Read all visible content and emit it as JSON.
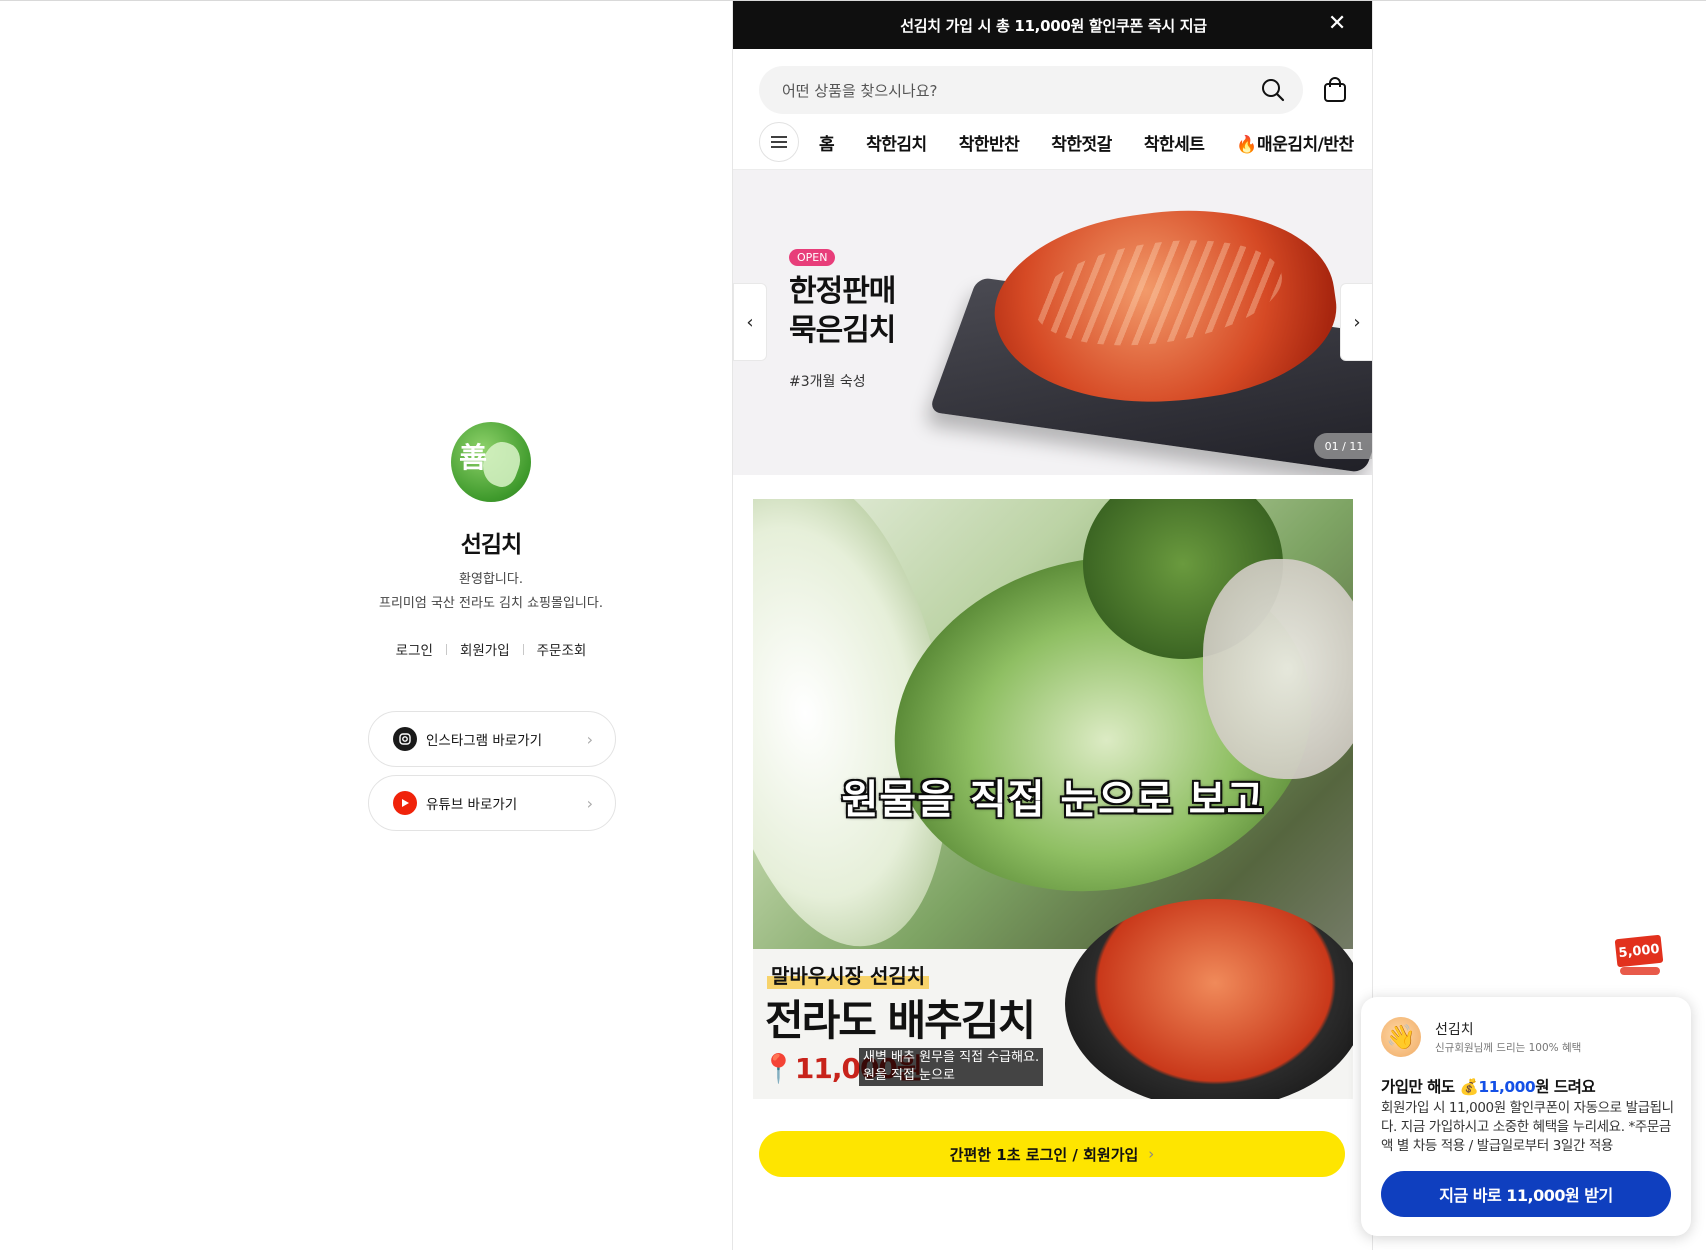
{
  "brand": {
    "name": "선김치",
    "logo_char": "善",
    "welcome_line1": "환영합니다.",
    "welcome_line2": "프리미엄 국산 전라도 김치 쇼핑몰입니다."
  },
  "auth_links": [
    "로그인",
    "회원가입",
    "주문조회"
  ],
  "social": {
    "instagram": "인스타그램 바로가기",
    "youtube": "유튜브 바로가기"
  },
  "promo_bar": {
    "text": "선김치 가입 시 총 11,000원 할인쿠폰 즉시 지급"
  },
  "search": {
    "placeholder": "어떤 상품을 찾으시나요?"
  },
  "nav": {
    "items": [
      "홈",
      "착한김치",
      "착한반찬",
      "착한젓갈",
      "착한세트",
      "🔥매운김치/반찬"
    ]
  },
  "banner": {
    "badge": "OPEN",
    "title_line1": "한정판매",
    "title_line2": "묵은김치",
    "tag": "#3개월 숙성",
    "counter": "01 / 11"
  },
  "video": {
    "caption": "원물을 직접 눈으로 보고",
    "market_label": "말바우시장 선김치",
    "title": "전라도 배추김치",
    "price_text": "📍11,000원",
    "subtitle_line1": "새벽 배추 원무을 직접 수급해요.",
    "subtitle_line2": "원을 직접 눈으로"
  },
  "login_button": {
    "label": "간편한 1초 로그인 / 회원가입",
    "chevron": "›"
  },
  "mini_coupon": {
    "amount": "5,000"
  },
  "popup": {
    "brand": "선김치",
    "sub": "신규회원님께 드리는 100% 혜택",
    "head_prefix": "가입만 해도 💰",
    "head_amount": "11,000",
    "head_suffix": "원 드려요",
    "body": "회원가입 시 11,000원 할인쿠폰이 자동으로 발급됩니다. 지금 가입하시고 소중한 혜택을 누리세요. *주문금액 별 차등 적용 / 발급일로부터 3일간 적용",
    "button": "지금 바로 11,000원 받기"
  },
  "colors": {
    "promo_bar_bg": "#0f0f0f",
    "kakao_yellow": "#fee500",
    "popup_button": "#0f3fbf",
    "highlight_blue": "#1450e6",
    "open_badge": "#e83e7a"
  }
}
